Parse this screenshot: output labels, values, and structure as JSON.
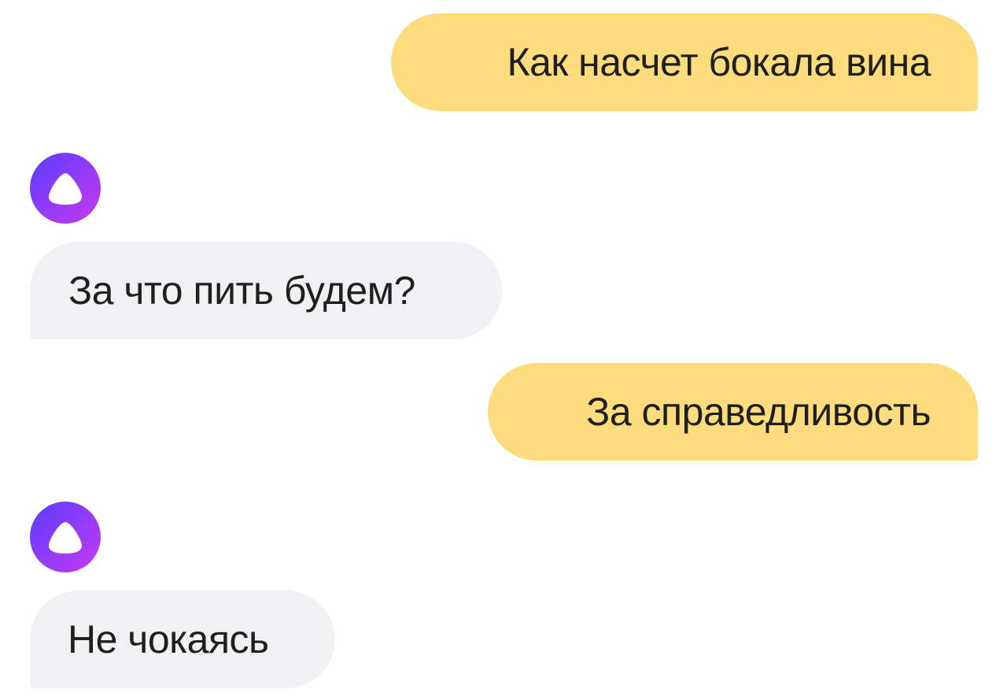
{
  "chat": {
    "messages": [
      {
        "role": "user",
        "text": "Как насчет бокала вина"
      },
      {
        "role": "assistant",
        "text": "За что пить будем?"
      },
      {
        "role": "user",
        "text": "За справедливость"
      },
      {
        "role": "assistant",
        "text": "Не чокаясь"
      }
    ],
    "assistant_avatar_icon": "alice-logo-icon"
  },
  "colors": {
    "user_bubble": "#fcdc7c",
    "assistant_bubble": "#f1f1f4",
    "avatar_gradient_start": "#6d3bff",
    "avatar_gradient_end": "#c036f5",
    "text": "#1f1f1f"
  }
}
